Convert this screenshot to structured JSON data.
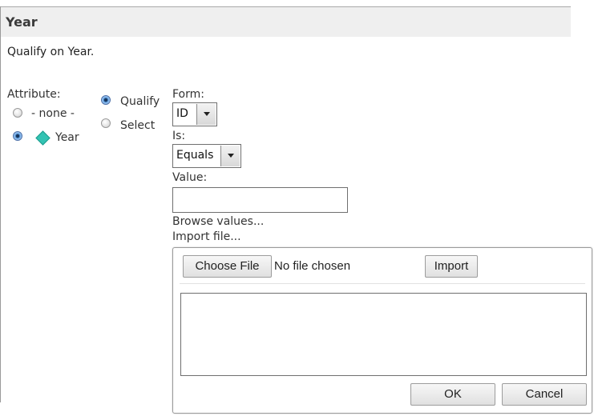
{
  "header": {
    "title": "Year"
  },
  "subtitle": "Qualify on Year.",
  "attribute": {
    "label": "Attribute:",
    "options": [
      {
        "label": "- none -",
        "checked": false
      },
      {
        "label": "Year",
        "checked": true,
        "icon": "attribute-diamond-icon"
      }
    ]
  },
  "mode": {
    "options": [
      {
        "label": "Qualify",
        "checked": true
      },
      {
        "label": "Select",
        "checked": false
      }
    ]
  },
  "form": {
    "label": "Form:",
    "value": "ID"
  },
  "is": {
    "label": "Is:",
    "value": "Equals"
  },
  "value_field": {
    "label": "Value:",
    "value": ""
  },
  "links": {
    "browse": "Browse values...",
    "import_file": "Import file..."
  },
  "import_panel": {
    "choose_file_label": "Choose File",
    "file_status": "No file chosen",
    "import_label": "Import",
    "ok_label": "OK",
    "cancel_label": "Cancel"
  },
  "colors": {
    "diamond": "#33c3b3",
    "radio_selected": "#5d9ddf",
    "header_bg": "#efefef"
  }
}
